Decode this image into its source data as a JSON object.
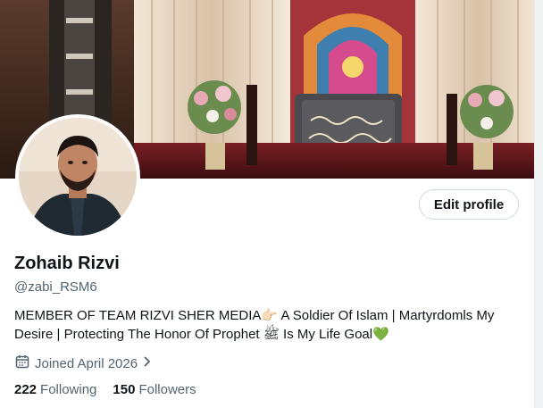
{
  "profile": {
    "name": "Zohaib Rizvi",
    "handle": "@zabi_RSM6",
    "bio_part1": "MEMBER OF TEAM RIZVI SHER MEDIA",
    "bio_emoji1": "👉🏻",
    "bio_part2": " A Soldier Of Islam | Martyrdomls My Desire | Protecting The Honor Of Prophet ",
    "bio_emoji2": "ﷺ",
    "bio_part3": " Is My Life Goal",
    "bio_emoji3": "💚",
    "joined": "Joined April 2026",
    "following_count": "222",
    "following_label": "Following",
    "followers_count": "150",
    "followers_label": "Followers"
  },
  "actions": {
    "edit_profile": "Edit profile"
  },
  "icons": {
    "calendar": "calendar-icon",
    "chevron": "chevron-right-icon"
  },
  "colors": {
    "text_primary": "#0f1419",
    "text_secondary": "#536471",
    "border": "#cfd9de",
    "heart": "#4caf50"
  }
}
